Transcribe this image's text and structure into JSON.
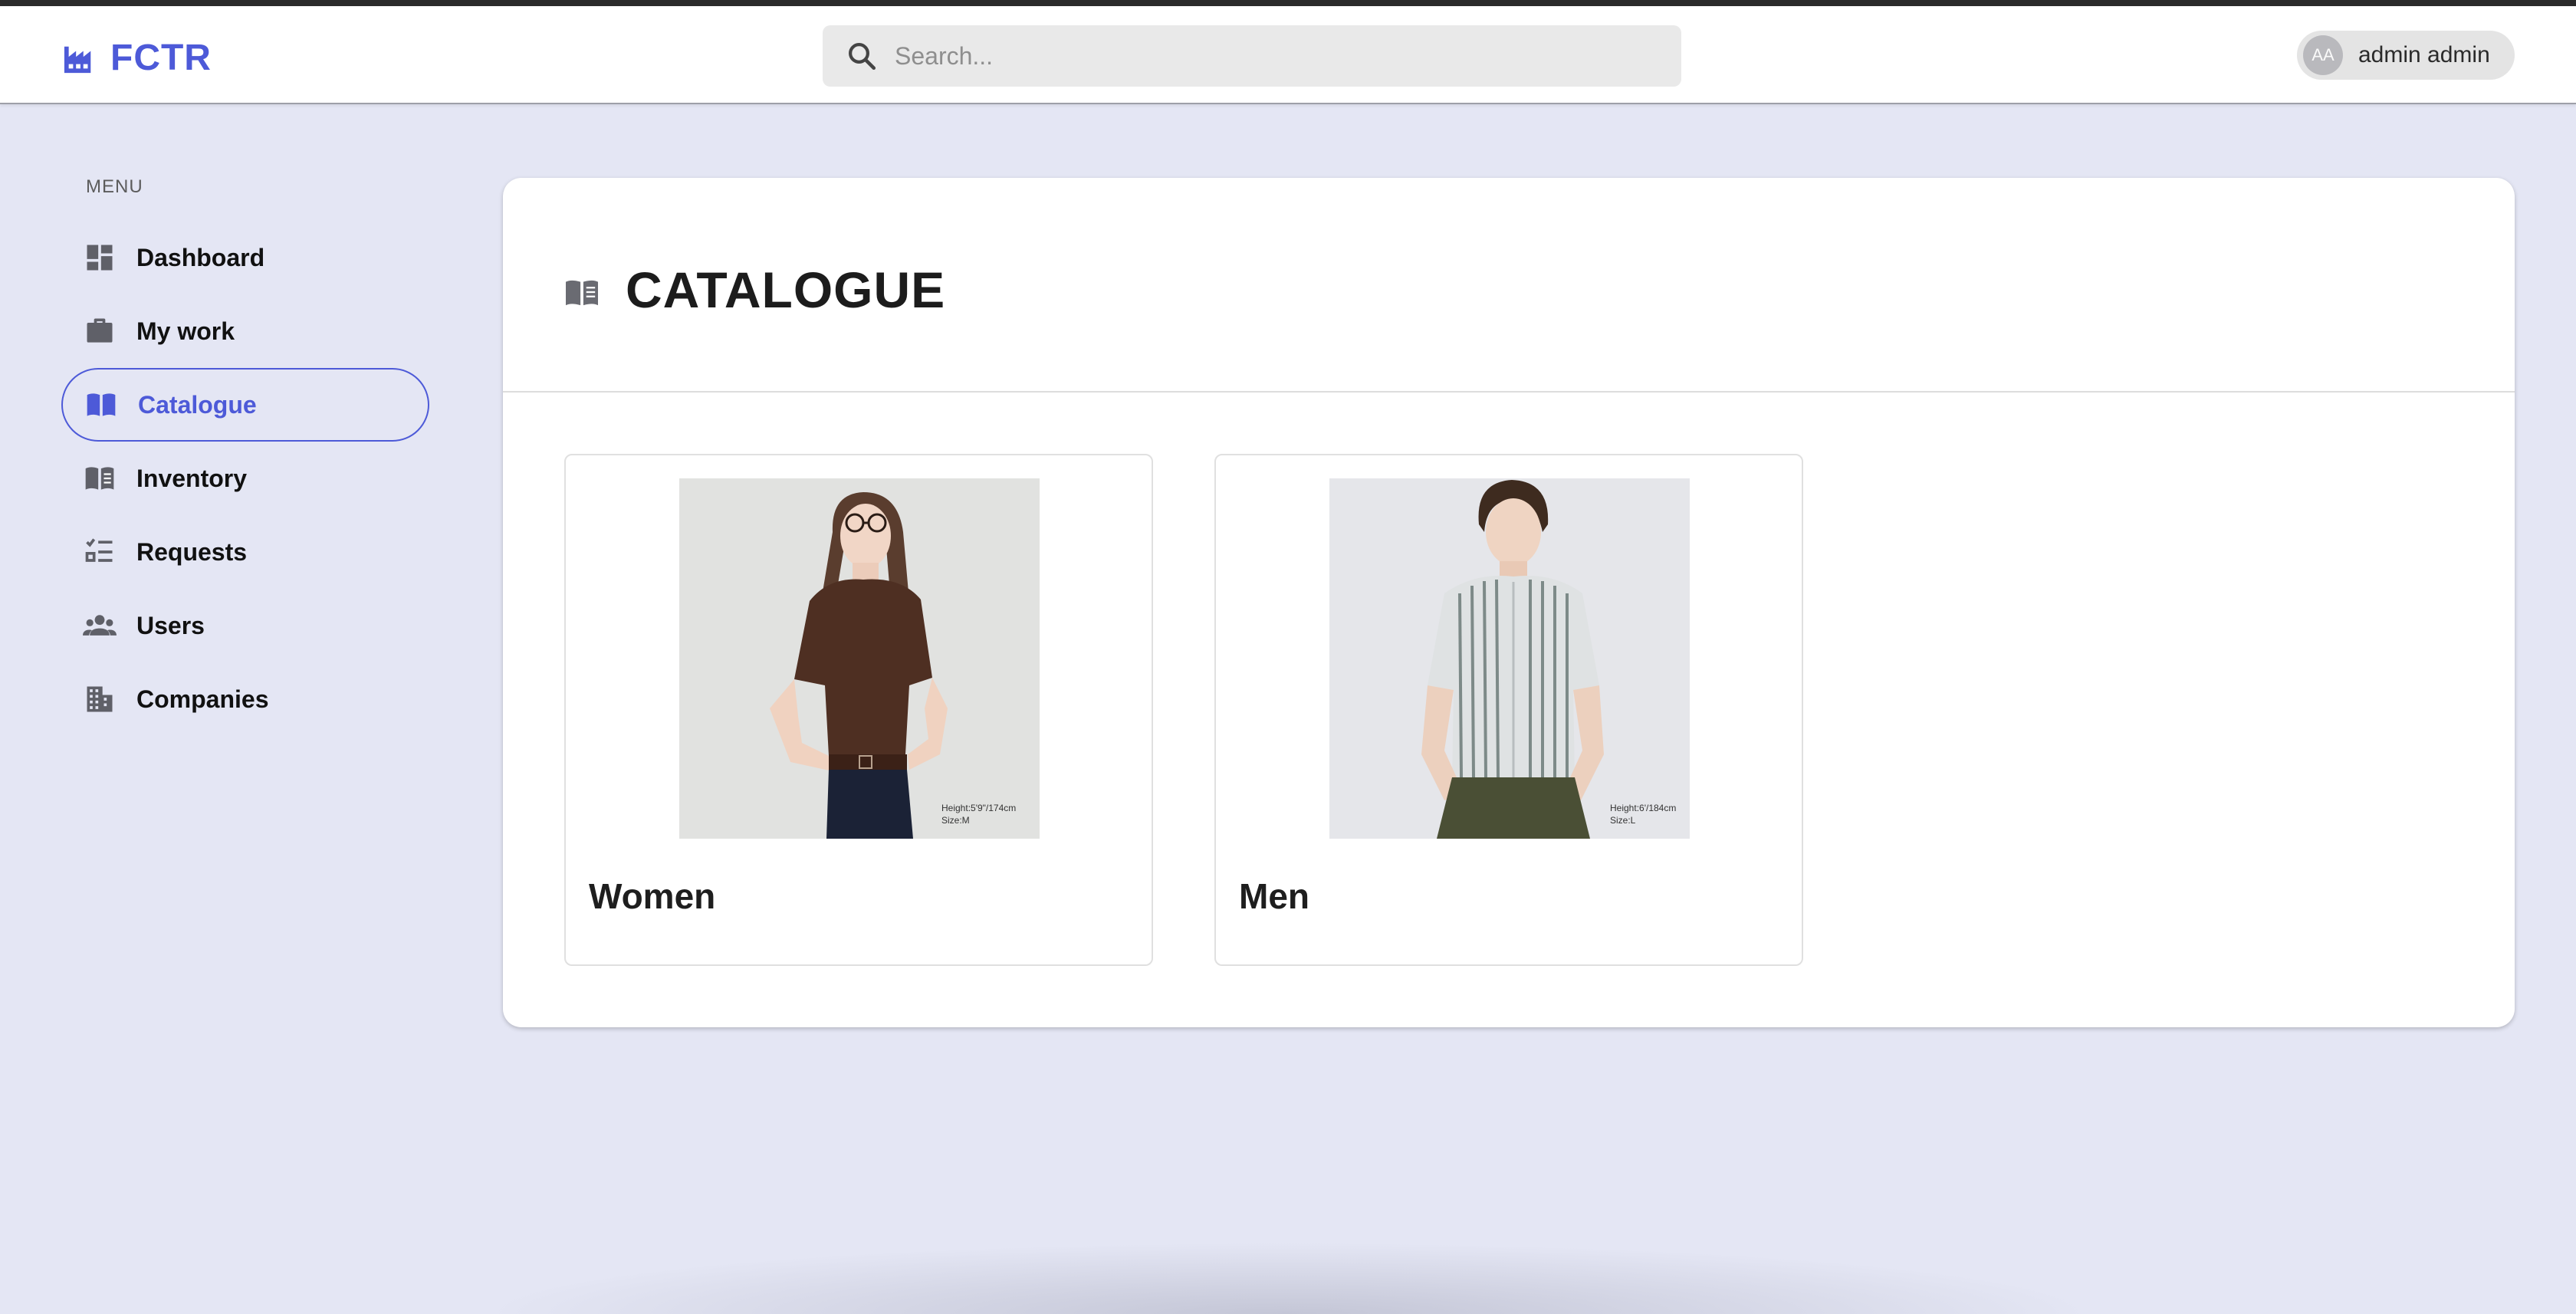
{
  "brand": {
    "name": "FCTR",
    "accent": "#4d5ad8"
  },
  "search": {
    "placeholder": "Search..."
  },
  "user": {
    "initials": "AA",
    "name": "admin admin"
  },
  "menu": {
    "title": "MENU",
    "items": [
      {
        "label": "Dashboard",
        "icon": "dashboard-icon",
        "active": false
      },
      {
        "label": "My work",
        "icon": "briefcase-icon",
        "active": false
      },
      {
        "label": "Catalogue",
        "icon": "open-book-icon",
        "active": true
      },
      {
        "label": "Inventory",
        "icon": "book-icon",
        "active": false
      },
      {
        "label": "Requests",
        "icon": "checklist-icon",
        "active": false
      },
      {
        "label": "Users",
        "icon": "users-icon",
        "active": false
      },
      {
        "label": "Companies",
        "icon": "building-icon",
        "active": false
      }
    ]
  },
  "page": {
    "title": "CATALOGUE",
    "icon": "book-icon"
  },
  "categories": [
    {
      "label": "Women",
      "caption": [
        "Height:5'9\"/174cm",
        "Size:M"
      ]
    },
    {
      "label": "Men",
      "caption": [
        "Height:6'/184cm",
        "Size:L"
      ]
    }
  ]
}
